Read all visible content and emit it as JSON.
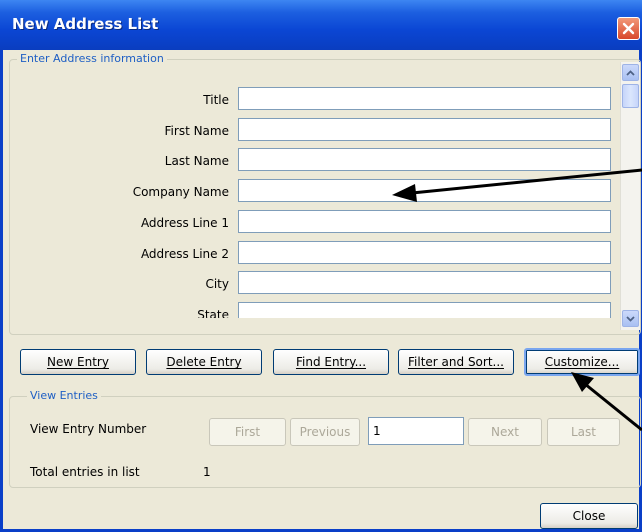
{
  "window": {
    "title": "New Address List"
  },
  "address_group": {
    "caption": "Enter Address information",
    "fields": [
      {
        "label": "Title",
        "value": ""
      },
      {
        "label": "First Name",
        "value": ""
      },
      {
        "label": "Last Name",
        "value": ""
      },
      {
        "label": "Company Name",
        "value": ""
      },
      {
        "label": "Address Line 1",
        "value": ""
      },
      {
        "label": "Address Line 2",
        "value": ""
      },
      {
        "label": "City",
        "value": ""
      },
      {
        "label": "State",
        "value": ""
      }
    ]
  },
  "buttons": {
    "new_entry": "New Entry",
    "delete_entry": "Delete Entry",
    "find_entry": "Find Entry...",
    "filter_sort": "Filter and Sort...",
    "customize": "Customize..."
  },
  "view_group": {
    "caption": "View Entries",
    "entry_number_label": "View Entry Number",
    "first": "First",
    "previous": "Previous",
    "entry_number_value": "1",
    "next": "Next",
    "last": "Last",
    "total_label": "Total entries in list",
    "total_value": "1"
  },
  "close_label": "Close",
  "colors": {
    "titlebar": "#0a46d4",
    "group_caption": "#1f5fc4",
    "dialog_bg": "#ece9d8",
    "arrow": "#000000"
  }
}
